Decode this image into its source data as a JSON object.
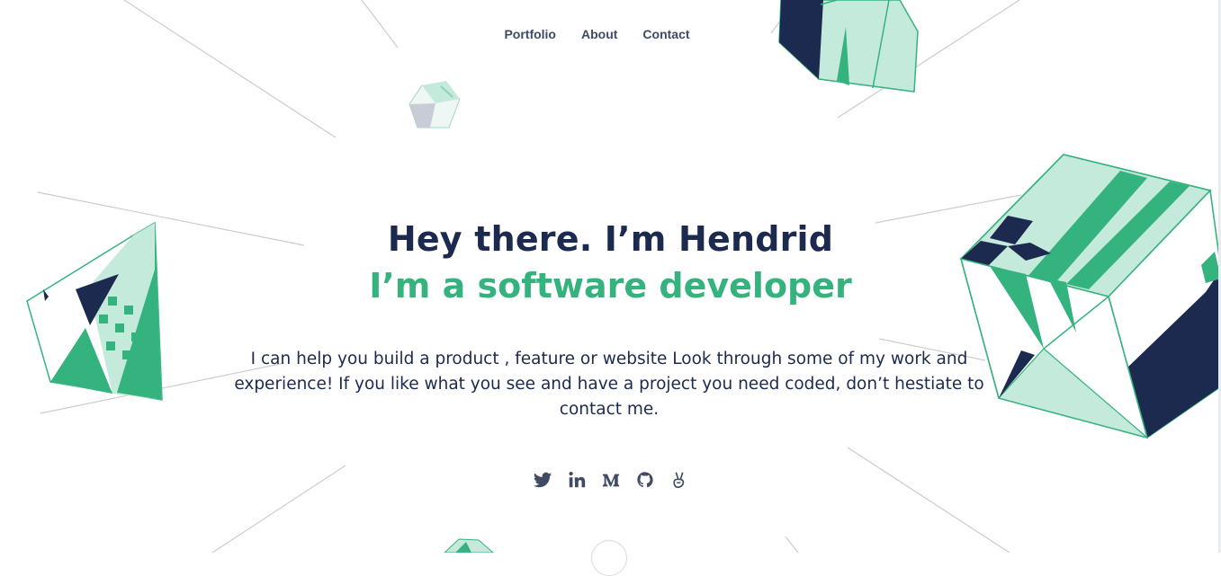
{
  "nav": {
    "items": [
      {
        "label": "Portfolio"
      },
      {
        "label": "About"
      },
      {
        "label": "Contact"
      }
    ]
  },
  "hero": {
    "greeting": "Hey there. I’m Hendrid",
    "role": "I’m a software developer",
    "intro": "I can help you build a product , feature or website Look through some of my work and experience! If you like what you see and have a project you need coded, don’t hestiate to contact me."
  },
  "social_links": [
    {
      "icon": "twitter-icon"
    },
    {
      "icon": "linkedin-icon"
    },
    {
      "icon": "medium-icon"
    },
    {
      "icon": "github-icon"
    },
    {
      "icon": "angellist-icon"
    }
  ],
  "colors": {
    "navy": "#1b2a4e",
    "green": "#35b37e",
    "mint": "#c4eadb",
    "text": "#3f4a63"
  }
}
